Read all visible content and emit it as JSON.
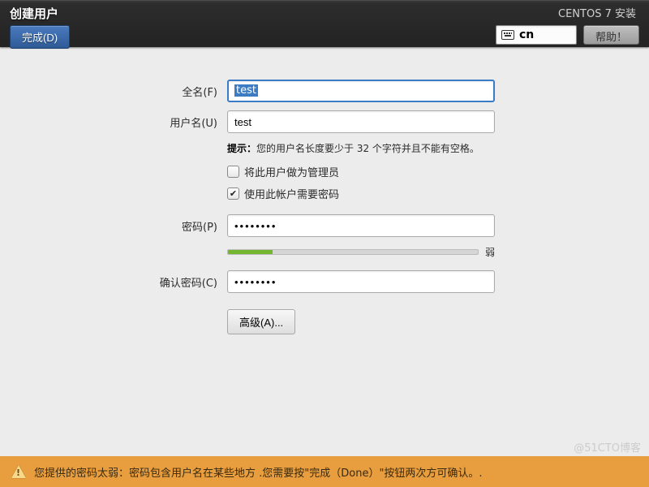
{
  "header": {
    "title": "创建用户",
    "done_label": "完成(D)",
    "installer_title": "CENTOS 7 安装",
    "keyboard_layout": "cn",
    "help_label": "帮助！"
  },
  "form": {
    "fullname_label": "全名(F)",
    "fullname_value": "test",
    "username_label": "用户名(U)",
    "username_value": "test",
    "hint_prefix": "提示：",
    "hint_text": "您的用户名长度要少于 32 个字符并且不能有空格。",
    "admin_checkbox": {
      "checked": false,
      "label": "将此用户做为管理员"
    },
    "require_pw_checkbox": {
      "checked": true,
      "label": "使用此帐户需要密码"
    },
    "password_label": "密码(P)",
    "password_value": "••••••••",
    "strength": {
      "percent": 18,
      "label": "弱"
    },
    "confirm_label": "确认密码(C)",
    "confirm_value": "••••••••",
    "advanced_label": "高级(A)..."
  },
  "warning": "您提供的密码太弱：密码包含用户名在某些地方 .您需要按\"完成（Done）\"按钮两次方可确认。.",
  "watermark": "@51CTO博客"
}
